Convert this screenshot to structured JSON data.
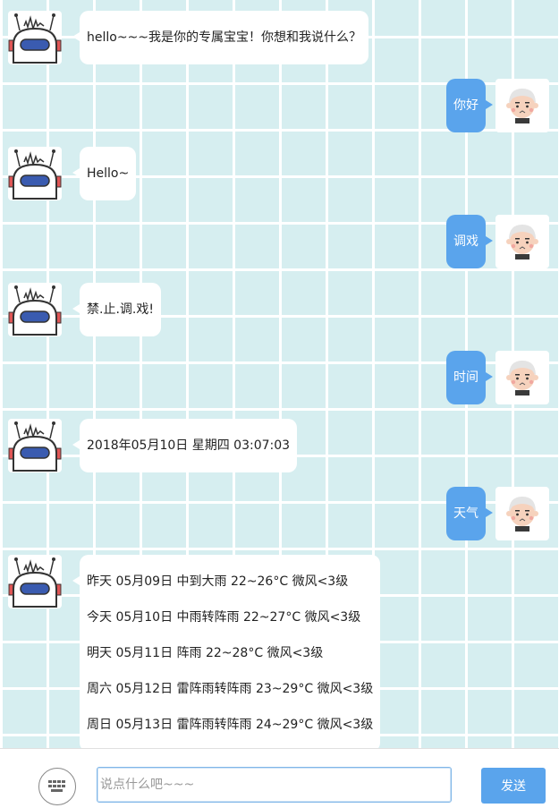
{
  "messages": [
    {
      "from": "bot",
      "text": "hello~~~我是你的专属宝宝！你想和我说什么？"
    },
    {
      "from": "user",
      "text": "你好"
    },
    {
      "from": "bot",
      "text": "Hello~"
    },
    {
      "from": "user",
      "text": "调戏"
    },
    {
      "from": "bot",
      "text": "禁.止.调.戏!"
    },
    {
      "from": "user",
      "text": "时间"
    },
    {
      "from": "bot",
      "text": "2018年05月10日 星期四 03:07:03"
    },
    {
      "from": "user",
      "text": "天气"
    },
    {
      "from": "bot",
      "lines": [
        "昨天 05月09日 中到大雨 22~26°C 微风<3级",
        "今天 05月10日 中雨转阵雨 22~27°C 微风<3级",
        "明天 05月11日 阵雨 22~28°C 微风<3级",
        "周六 05月12日 雷阵雨转阵雨 23~29°C 微风<3级",
        "周日 05月13日 雷阵雨转阵雨 24~29°C 微风<3级"
      ]
    }
  ],
  "input": {
    "placeholder": "说点什么吧~~~",
    "value": ""
  },
  "send_label": "发送",
  "icons": {
    "bot_avatar": "robot-avatar-icon",
    "user_avatar": "user-avatar-icon",
    "keyboard": "keyboard-icon"
  },
  "colors": {
    "chat_bg": "#d6eef0",
    "user_bubble": "#5aa4ec",
    "bot_bubble": "#ffffff",
    "send_button": "#5aa4ec"
  }
}
